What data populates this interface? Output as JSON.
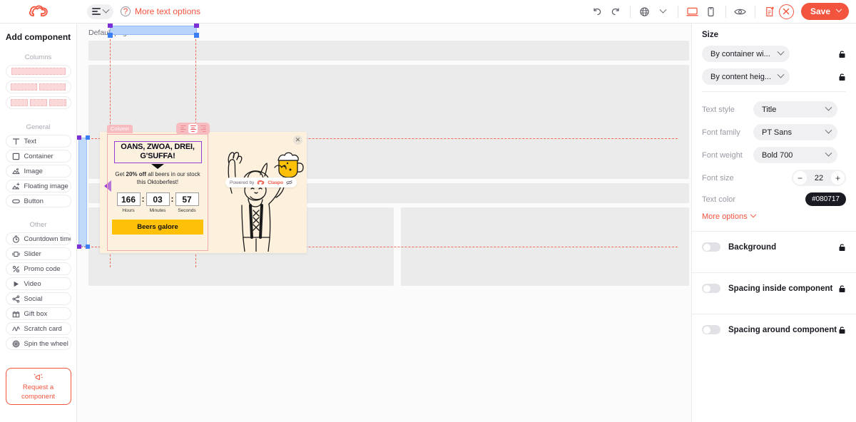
{
  "topbar": {
    "logo": "claspo-cloud-logo",
    "align_button": "text-align-icon",
    "more_text_options": "More text options",
    "undo": "undo-icon",
    "redo": "redo-icon",
    "globe": "globe-icon",
    "desktop": "desktop-icon",
    "mobile": "mobile-icon",
    "preview": "eye-icon",
    "page_doc": "document-icon",
    "close": "✕",
    "save_label": "Save"
  },
  "sidebar": {
    "title": "Add component",
    "groups": [
      {
        "label": "Columns"
      },
      {
        "label": "General"
      },
      {
        "label": "Other"
      }
    ],
    "columns": [
      {
        "name": "one-column",
        "segments": 1
      },
      {
        "name": "two-columns",
        "segments": 2
      },
      {
        "name": "three-columns",
        "segments": 3
      }
    ],
    "general": [
      {
        "label": "Text",
        "icon": "text-icon"
      },
      {
        "label": "Container",
        "icon": "container-icon"
      },
      {
        "label": "Image",
        "icon": "image-icon"
      },
      {
        "label": "Floating image",
        "icon": "floating-image-icon"
      },
      {
        "label": "Button",
        "icon": "button-icon"
      }
    ],
    "other": [
      {
        "label": "Countdown time",
        "icon": "timer-icon"
      },
      {
        "label": "Slider",
        "icon": "slider-icon"
      },
      {
        "label": "Promo code",
        "icon": "percent-icon"
      },
      {
        "label": "Video",
        "icon": "play-icon"
      },
      {
        "label": "Social",
        "icon": "share-icon"
      },
      {
        "label": "Gift box",
        "icon": "gift-icon"
      },
      {
        "label": "Scratch card",
        "icon": "scratch-icon"
      },
      {
        "label": "Spin the wheel",
        "icon": "wheel-icon"
      }
    ],
    "request": {
      "line1": "Request a",
      "line2": "component",
      "icon": "megaphone-icon"
    }
  },
  "canvas": {
    "page_label": "Default page",
    "popup": {
      "close_icon": "✕",
      "column_badge": "Column",
      "align_options": [
        "align-left",
        "align-center",
        "align-right"
      ],
      "align_selected": "align-center",
      "headline": "OANS, ZWOA, DREI, G'SUFFA!",
      "sub_pre": "Get ",
      "sub_strong": "20% off",
      "sub_post": " all beers in our stock this Oktoberfest!",
      "timer": [
        {
          "value": "166",
          "label": "Hours"
        },
        {
          "value": "03",
          "label": "Minutes"
        },
        {
          "value": "57",
          "label": "Seconds"
        }
      ],
      "separator": ":",
      "cta_label": "Beers galore",
      "image_alt": "oktoberfest-man-with-beer-illustration"
    },
    "powered": {
      "text": "Powered by",
      "brand": "Claspo",
      "hide_icon": "eye-off-icon"
    }
  },
  "right_panel": {
    "size_title": "Size",
    "size_width": "By container wi...",
    "size_height": "By content heig...",
    "text_style_label": "Text style",
    "text_style_value": "Title",
    "font_family_label": "Font family",
    "font_family_value": "PT Sans",
    "font_weight_label": "Font weight",
    "font_weight_value": "Bold 700",
    "font_size_label": "Font size",
    "font_size_value": "22",
    "font_size_minus": "−",
    "font_size_plus": "+",
    "text_color_label": "Text color",
    "text_color_value": "#080717",
    "more_options": "More options",
    "toggles": [
      {
        "label": "Background",
        "state": "off"
      },
      {
        "label": "Spacing inside component",
        "state": "off"
      },
      {
        "label": "Spacing around component",
        "state": "off"
      }
    ],
    "lock_icon": "lock-icon"
  },
  "colors": {
    "accent": "#f2543d",
    "popup_bg": "#fdf1de",
    "cta": "#ffc107",
    "selection_purple": "#9b3fd4",
    "selection_blue": "#b9d4fb"
  }
}
